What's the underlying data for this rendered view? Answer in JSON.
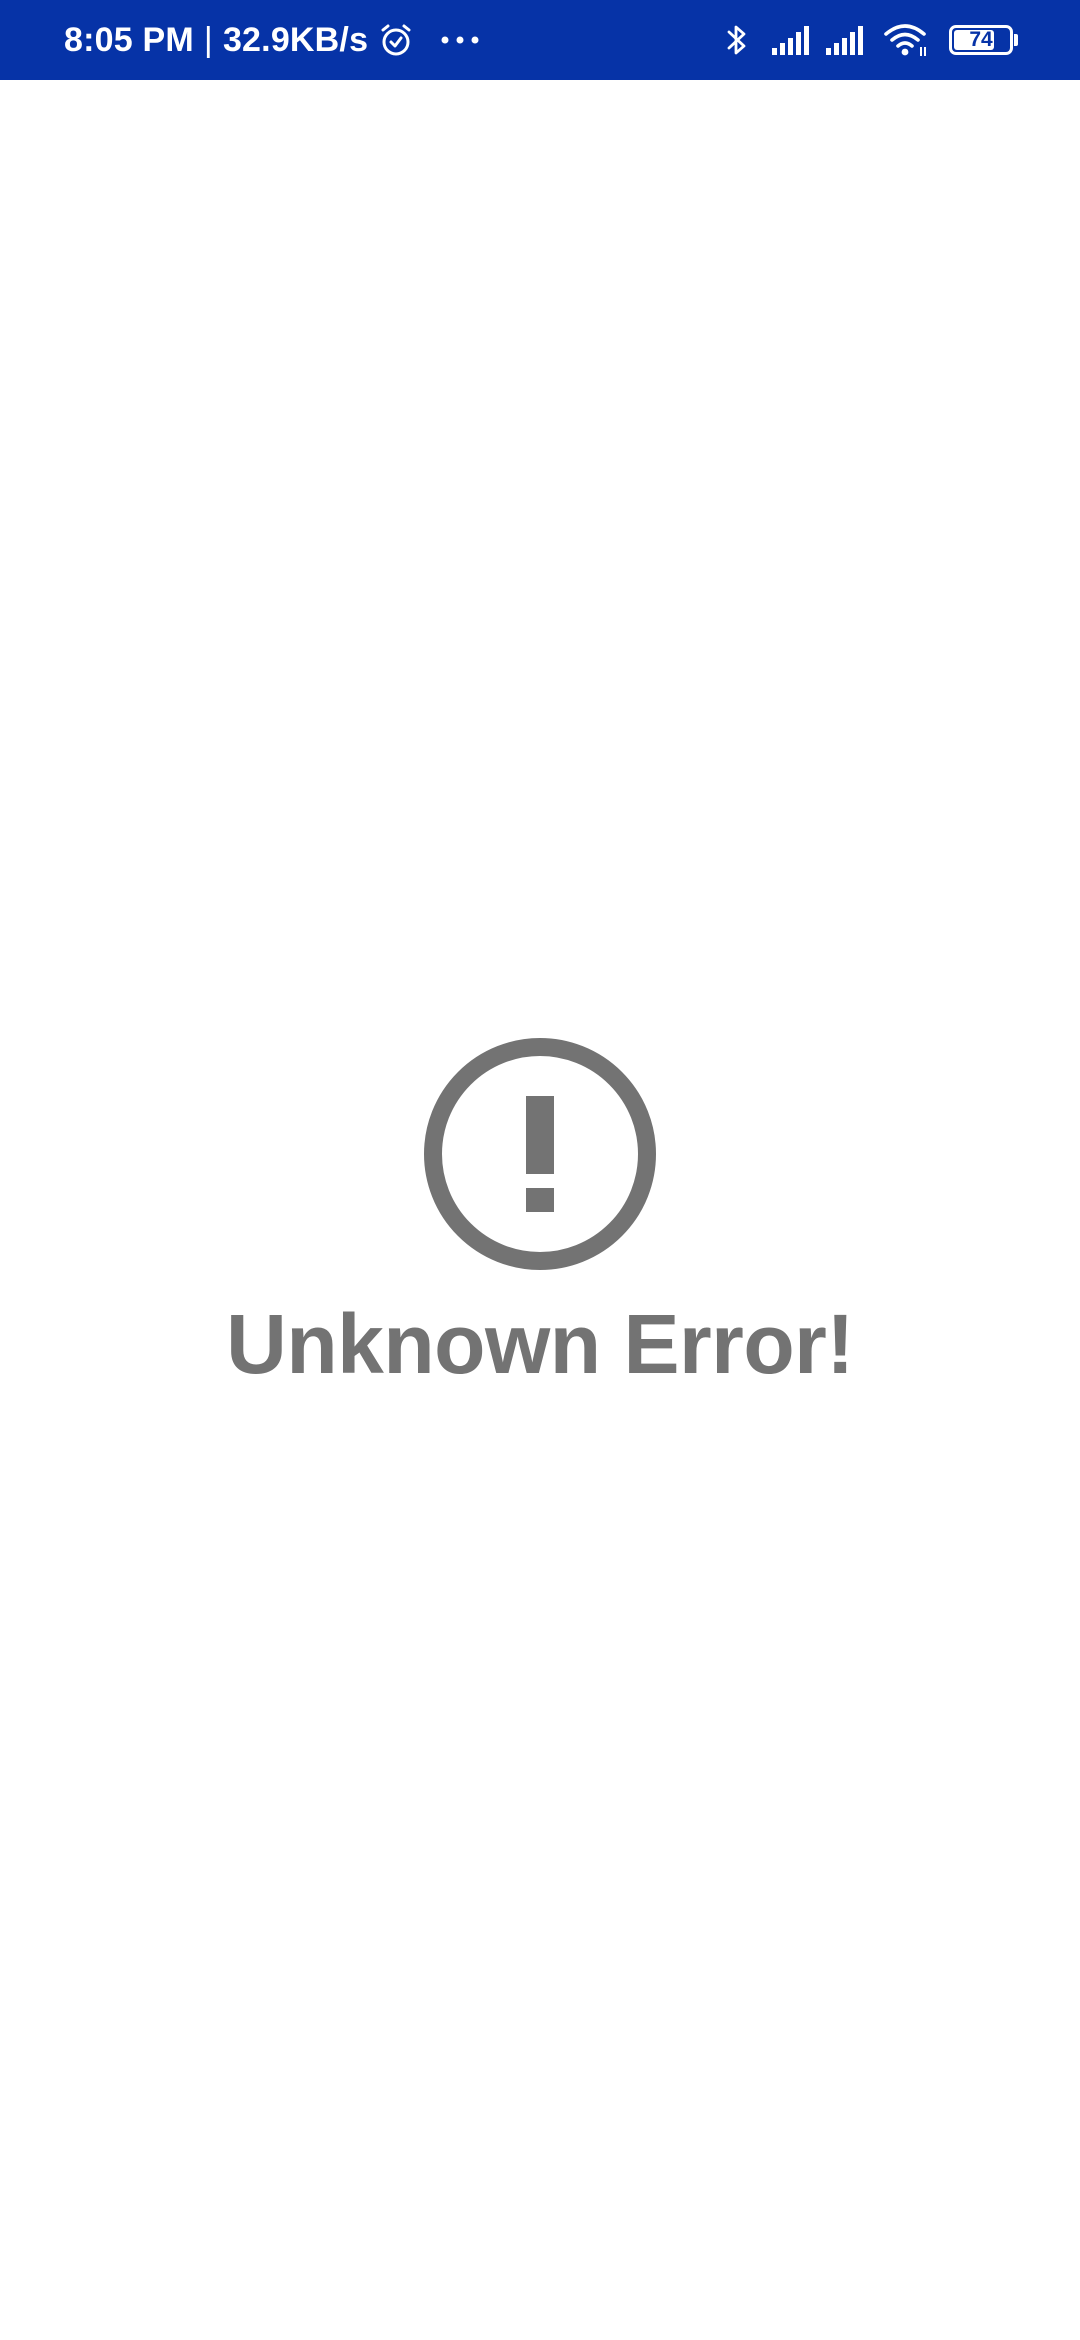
{
  "status_bar": {
    "time": "8:05 PM",
    "separator": "|",
    "network_speed": "32.9KB/s",
    "battery_level": "74",
    "battery_fraction": 0.74,
    "background_color": "#0633a7",
    "icons": [
      "alarm-icon",
      "more-dots-icon",
      "bluetooth-icon",
      "signal-icon",
      "signal-icon",
      "wifi-icon",
      "battery-icon"
    ]
  },
  "error": {
    "icon": "exclamation-circle-icon",
    "message": "Unknown Error!",
    "color": "#737373"
  }
}
